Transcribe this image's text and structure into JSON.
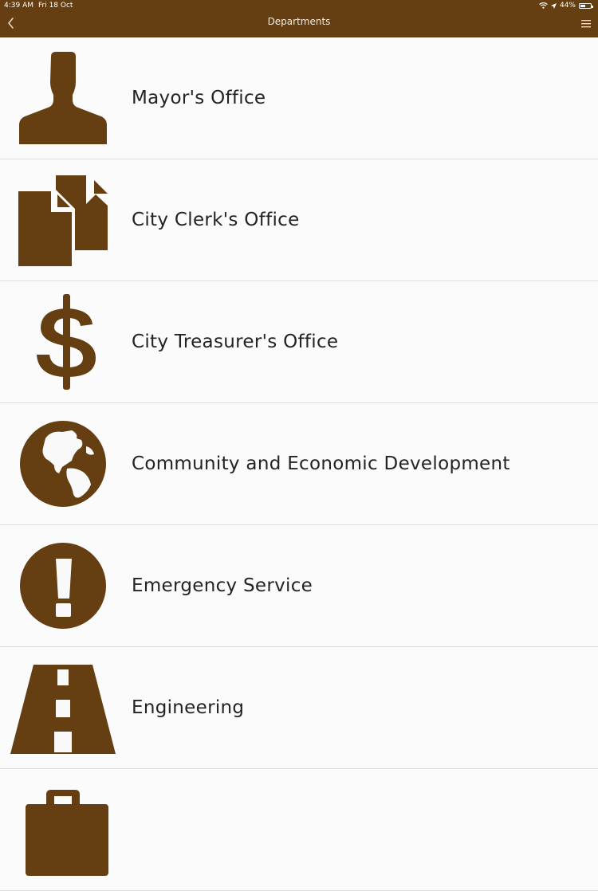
{
  "status_bar": {
    "time": "4:39 AM",
    "date": "Fri 18 Oct",
    "battery": "44%"
  },
  "nav": {
    "title": "Departments"
  },
  "colors": {
    "brand": "#653f11",
    "icon": "#653f11",
    "text": "#232323",
    "divider": "#dcdcdf",
    "background": "#f9f9fa"
  },
  "departments": [
    {
      "label": "Mayor's Office",
      "icon": "person-icon"
    },
    {
      "label": "City Clerk's Office",
      "icon": "documents-icon"
    },
    {
      "label": "City Treasurer's Office",
      "icon": "dollar-icon"
    },
    {
      "label": "Community and Economic Development",
      "icon": "globe-icon"
    },
    {
      "label": "Emergency Service",
      "icon": "exclamation-icon"
    },
    {
      "label": "Engineering",
      "icon": "road-icon"
    },
    {
      "label": "",
      "icon": "briefcase-icon"
    }
  ]
}
